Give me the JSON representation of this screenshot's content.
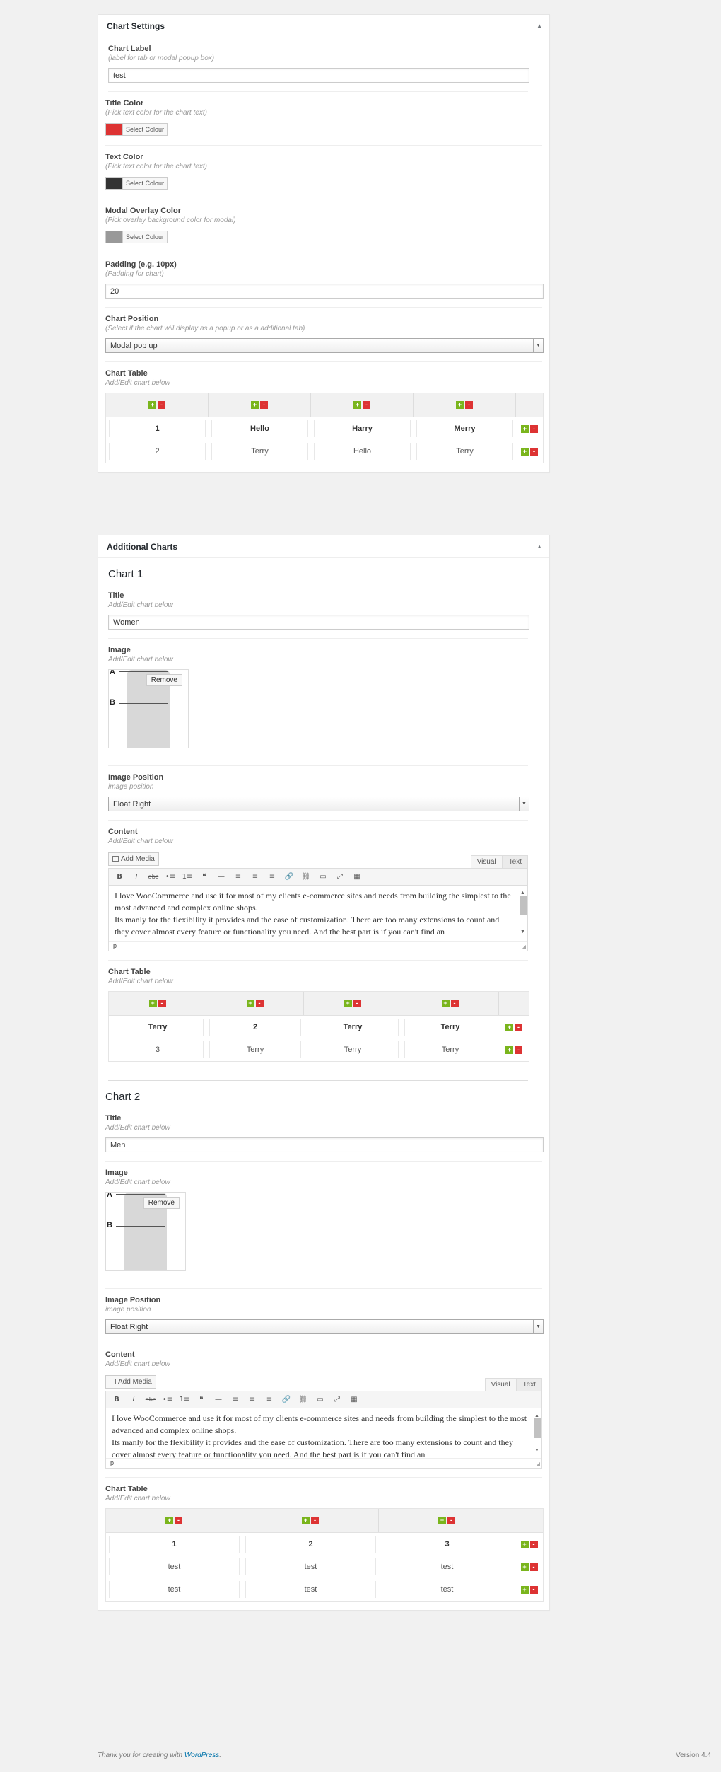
{
  "chart_settings": {
    "heading": "Chart Settings",
    "label": {
      "label": "Chart Label",
      "hint": "(label for tab or modal popup box)",
      "value": "test"
    },
    "title_color": {
      "label": "Title Color",
      "hint": "(Pick text color for the chart text)",
      "color": "#dd3333",
      "button": "Select Colour"
    },
    "text_color": {
      "label": "Text Color",
      "hint": "(Pick text color for the chart text)",
      "color": "#333333",
      "button": "Select Colour"
    },
    "overlay_color": {
      "label": "Modal Overlay Color",
      "hint": "(Pick overlay background color for modal)",
      "color": "#999999",
      "button": "Select Colour"
    },
    "padding": {
      "label": "Padding (e.g. 10px)",
      "hint": "(Padding for chart)",
      "value": "20"
    },
    "position": {
      "label": "Chart Position",
      "hint": "(Select if the chart will display as a popup or as a additional tab)",
      "value": "Modal pop up"
    },
    "table": {
      "label": "Chart Table",
      "hint": "Add/Edit chart below",
      "rows": [
        [
          "1",
          "Hello",
          "Harry",
          "Merry"
        ],
        [
          "2",
          "Terry",
          "Hello",
          "Terry"
        ]
      ]
    }
  },
  "additional": {
    "heading": "Additional Charts",
    "charts": [
      {
        "heading": "Chart 1",
        "title_label": "Title",
        "title_hint": "Add/Edit chart below",
        "title_value": "Women",
        "image_label": "Image",
        "image_hint": "Add/Edit chart below",
        "remove": "Remove",
        "letter_a": "A",
        "letter_b": "B",
        "pos_label": "Image Position",
        "pos_hint": "image position",
        "pos_value": "Float Right",
        "content_label": "Content",
        "content_hint": "Add/Edit chart below",
        "add_media": "Add Media",
        "tab_visual": "Visual",
        "tab_text": "Text",
        "content_lines": [
          "I love WooCommerce and use it for most of my clients e-commerce sites and needs from building the simplest to the most advanced and complex online shops.",
          "Its manly for the flexibility it provides and the ease of customization. There are too many extensions to count and they cover almost every feature or functionality you need. And the best part is if you can't find an"
        ],
        "status": "p",
        "table_label": "Chart Table",
        "table_hint": "Add/Edit chart below",
        "rows": [
          [
            "Terry",
            "2",
            "Terry",
            "Terry"
          ],
          [
            "3",
            "Terry",
            "Terry",
            "Terry"
          ]
        ]
      },
      {
        "heading": "Chart 2",
        "title_label": "Title",
        "title_hint": "Add/Edit chart below",
        "title_value": "Men",
        "image_label": "Image",
        "image_hint": "Add/Edit chart below",
        "remove": "Remove",
        "letter_a": "A",
        "letter_b": "B",
        "pos_label": "Image Position",
        "pos_hint": "image position",
        "pos_value": "Float Right",
        "content_label": "Content",
        "content_hint": "Add/Edit chart below",
        "add_media": "Add Media",
        "tab_visual": "Visual",
        "tab_text": "Text",
        "content_lines": [
          "I love WooCommerce and use it for most of my clients e-commerce sites and needs from building the simplest to the most advanced and complex online shops.",
          "Its manly for the flexibility it provides and the ease of customization. There are too many extensions to count and they cover almost every feature or functionality you need. And the best part is if you can't find an"
        ],
        "status": "p",
        "table_label": "Chart Table",
        "table_hint": "Add/Edit chart below",
        "rows": [
          [
            "1",
            "2",
            "3"
          ],
          [
            "test",
            "test",
            "test"
          ],
          [
            "test",
            "test",
            "test"
          ]
        ]
      }
    ]
  },
  "footer": {
    "thanks": "Thank you for creating with",
    "link": "WordPress",
    "period": ".",
    "version": "Version 4.4"
  },
  "icons": {
    "plus": "+",
    "minus": "-",
    "toggle": "▲",
    "select_arrow": "▼",
    "toolbar": [
      "B",
      "I",
      "abc",
      "•≡",
      "1≡",
      "❝",
      "—",
      "≡",
      "≡",
      "≡",
      "🔗",
      "⛓",
      "▭",
      "⤢",
      "▦"
    ]
  }
}
